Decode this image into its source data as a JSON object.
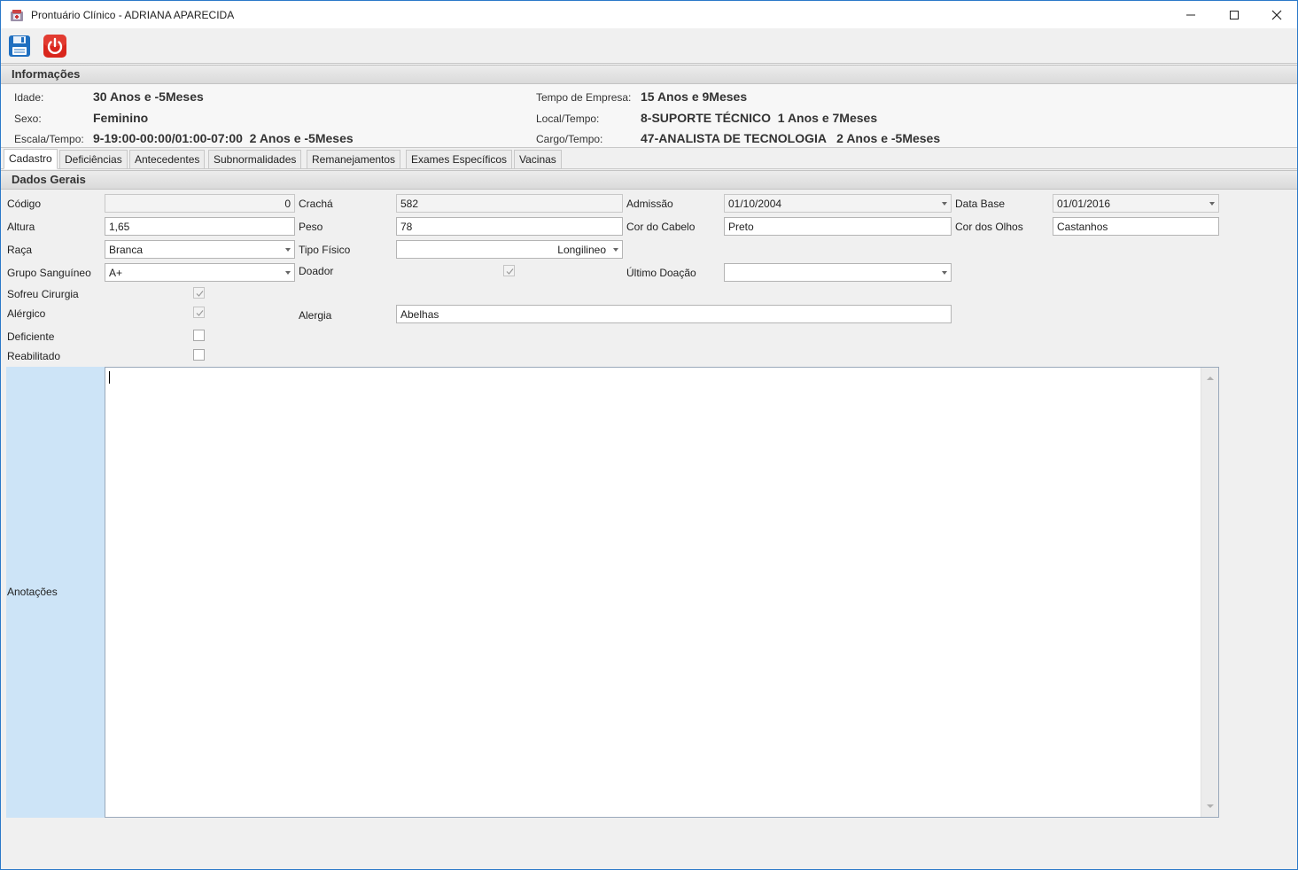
{
  "window": {
    "title": "Prontuário Clínico - ADRIANA APARECIDA",
    "minimize_icon": "minimize-icon",
    "maximize_icon": "maximize-icon",
    "close_icon": "close-icon"
  },
  "toolbar": {
    "save_icon": "floppy-disk-icon",
    "exit_icon": "power-icon"
  },
  "info": {
    "header": "Informações",
    "idade_label": "Idade:",
    "idade_value": "30 Anos e -5Meses",
    "sexo_label": "Sexo:",
    "sexo_value": "Feminino",
    "escala_label": "Escala/Tempo:",
    "escala_value": "9-19:00-00:00/01:00-07:00  2 Anos e -5Meses",
    "tempo_empresa_label": "Tempo de Empresa:",
    "tempo_empresa_value": "15 Anos e 9Meses",
    "local_label": "Local/Tempo:",
    "local_value": "8-SUPORTE TÉCNICO  1 Anos e 7Meses",
    "cargo_label": "Cargo/Tempo:",
    "cargo_value": "47-ANALISTA DE TECNOLOGIA   2 Anos e -5Meses"
  },
  "tabs": [
    "Cadastro",
    "Deficiências",
    "Antecedentes",
    "Subnormalidades",
    "Remanejamentos",
    "Exames Específicos",
    "Vacinas"
  ],
  "active_tab": "Cadastro",
  "form": {
    "header": "Dados Gerais",
    "codigo_label": "Código",
    "codigo_value": "0",
    "cracha_label": "Crachá",
    "cracha_value": "582",
    "admissao_label": "Admissão",
    "admissao_value": "01/10/2004",
    "data_base_label": "Data Base",
    "data_base_value": "01/01/2016",
    "altura_label": "Altura",
    "altura_value": "1,65",
    "peso_label": "Peso",
    "peso_value": "78",
    "cor_cabelo_label": "Cor do Cabelo",
    "cor_cabelo_value": "Preto",
    "cor_olhos_label": "Cor dos Olhos",
    "cor_olhos_value": "Castanhos",
    "raca_label": "Raça",
    "raca_value": "Branca",
    "tipo_fisico_label": "Tipo Físico",
    "tipo_fisico_value": "Longilineo",
    "grupo_sanguineo_label": "Grupo Sanguíneo",
    "grupo_sanguineo_value": "A+",
    "doador_label": "Doador",
    "doador_checked": true,
    "ultimo_doacao_label": "Último Doação",
    "ultimo_doacao_value": "",
    "sofreu_cirurgia_label": "Sofreu Cirurgia",
    "sofreu_cirurgia_checked": true,
    "alergico_label": "Alérgico",
    "alergico_checked": true,
    "alergia_label": "Alergia",
    "alergia_value": "Abelhas",
    "deficiente_label": "Deficiente",
    "deficiente_checked": false,
    "reabilitado_label": "Reabilitado",
    "reabilitado_checked": false,
    "anotacoes_label": "Anotações",
    "anotacoes_value": ""
  },
  "colors": {
    "window_border": "#2b79c9",
    "notes_label_bg": "#cde4f7",
    "exit_button": "#d9261c",
    "save_button": "#1f6fc0"
  }
}
